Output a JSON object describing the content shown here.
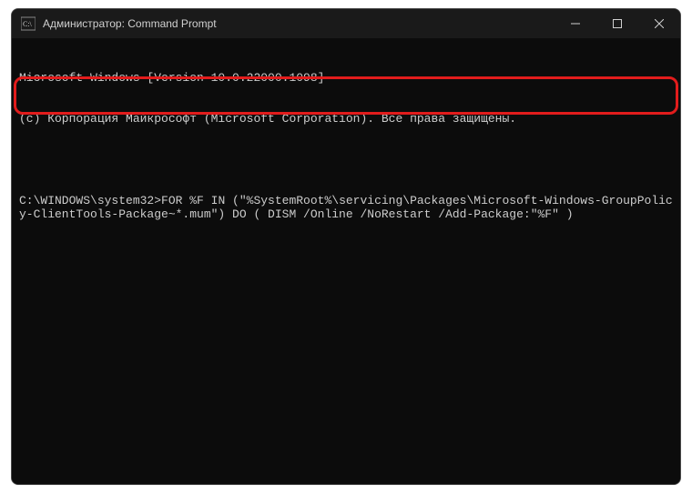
{
  "titlebar": {
    "title": "Администратор: Command Prompt"
  },
  "terminal": {
    "line1": "Microsoft Windows [Version 10.0.22000.1098]",
    "line2": "(c) Корпорация Майкрософт (Microsoft Corporation). Все права защищены.",
    "prompt": "C:\\WINDOWS\\system32>",
    "command": "FOR %F IN (\"%SystemRoot%\\servicing\\Packages\\Microsoft-Windows-GroupPolicy-ClientTools-Package~*.mum\") DO ( DISM /Online /NoRestart /Add-Package:\"%F\" )"
  }
}
